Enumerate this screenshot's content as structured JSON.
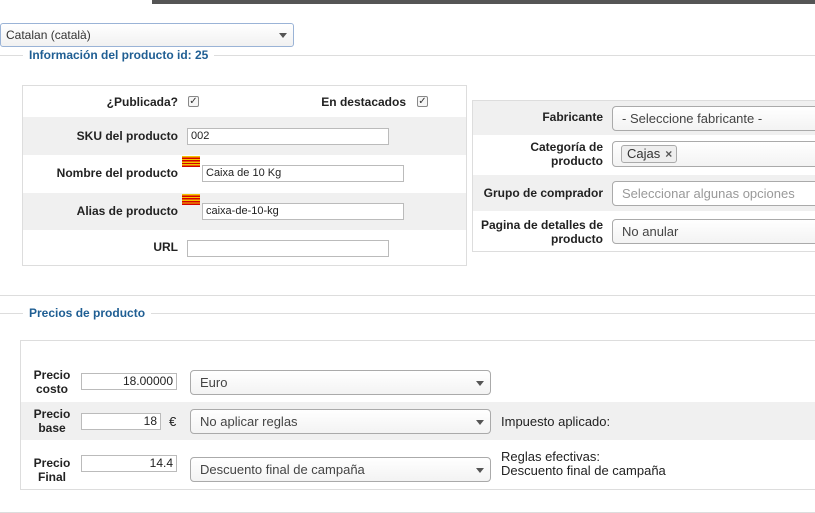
{
  "language_select": {
    "value": "Catalan (català)"
  },
  "product_info": {
    "legend": "Información del producto id: 25",
    "published_label": "¿Publicada?",
    "published_checked": true,
    "featured_label": "En destacados",
    "featured_checked": true,
    "sku_label": "SKU del producto",
    "sku_value": "002",
    "name_label": "Nombre del producto",
    "name_value": "Caixa de 10 Kg",
    "alias_label": "Alias de producto",
    "alias_value": "caixa-de-10-kg",
    "url_label": "URL",
    "url_value": "",
    "flag_icon": "catalan-flag-icon"
  },
  "right_panel": {
    "manufacturer_label": "Fabricante",
    "manufacturer_value": "- Seleccione fabricante -",
    "category_label": "Categoría de producto",
    "category_tag": "Cajas",
    "category_remove": "×",
    "shopper_group_label": "Grupo de comprador",
    "shopper_group_placeholder": "Seleccionar algunas opciones",
    "details_page_label": "Pagina de detalles de producto",
    "details_page_value": "No anular"
  },
  "prices": {
    "legend": "Precios de producto",
    "cost_label": "Precio costo",
    "cost_value": "18.00000",
    "currency_value": "Euro",
    "base_label": "Precio base",
    "base_value": "18",
    "base_currency_symbol": "€",
    "rules_value": "No aplicar reglas",
    "tax_applied_label": "Impuesto aplicado:",
    "final_label": "Precio Final",
    "final_value": "14.4",
    "discount_value": "Descuento final de campaña",
    "effective_rules_label": "Reglas efectivas:",
    "effective_rules_value": "Descuento final de campaña"
  }
}
